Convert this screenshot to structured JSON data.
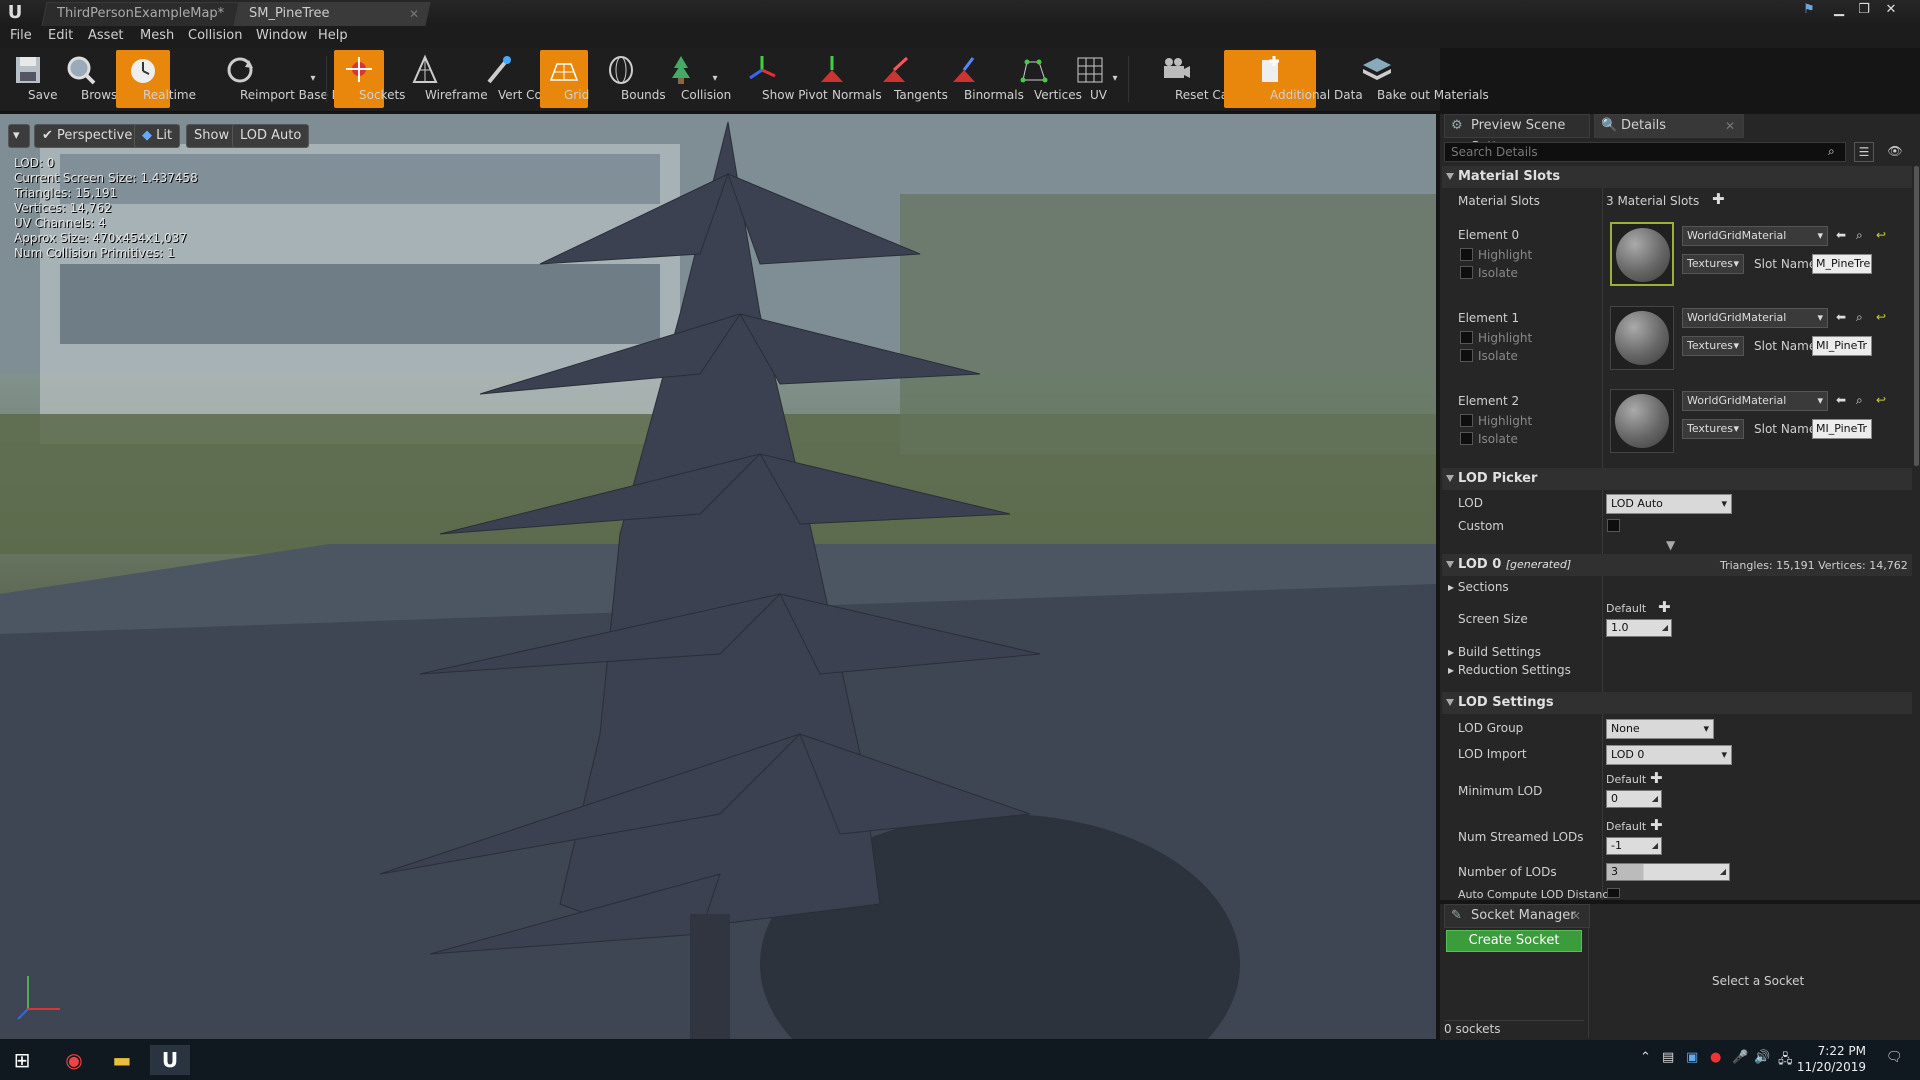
{
  "tabs": [
    {
      "label": "ThirdPersonExampleMap*"
    },
    {
      "label": "SM_PineTree"
    }
  ],
  "menu": [
    "File",
    "Edit",
    "Asset",
    "Mesh",
    "Collision",
    "Window",
    "Help"
  ],
  "toolbar": {
    "save": "Save",
    "browse": "Browse",
    "realtime": "Realtime",
    "reimport": "Reimport Base Mesh",
    "sockets": "Sockets",
    "wireframe": "Wireframe",
    "vert_colors": "Vert Colors",
    "grid": "Grid",
    "bounds": "Bounds",
    "collision": "Collision",
    "show_pivot": "Show Pivot",
    "normals": "Normals",
    "tangents": "Tangents",
    "binormals": "Binormals",
    "vertices": "Vertices",
    "uv": "UV",
    "reset_camera": "Reset Camera",
    "additional_data": "Additional Data",
    "bake_out": "Bake out Materials",
    "accent": "#e8870c"
  },
  "viewport": {
    "perspective": "Perspective",
    "lit": "Lit",
    "show": "Show",
    "lod_auto": "LOD Auto",
    "stats": [
      "LOD:  0",
      "Current Screen Size:  1.437458",
      "Triangles:  15,191",
      "Vertices:  14,762",
      "UV Channels:  4",
      "Approx Size: 470x454x1,037",
      "Num Collision Primitives:  1"
    ]
  },
  "details": {
    "tab_preview": "Preview Scene Sett",
    "tab_details": "Details",
    "search_placeholder": "Search Details",
    "material_slots_section": "Material Slots",
    "material_slots_label": "Material Slots",
    "material_slots_count": "3 Material Slots",
    "highlight": "Highlight",
    "isolate": "Isolate",
    "textures": "Textures",
    "slot_name_label": "Slot Name",
    "elements": [
      {
        "name": "Element 0",
        "material": "WorldGridMaterial",
        "slot": "M_PineTre"
      },
      {
        "name": "Element 1",
        "material": "WorldGridMaterial",
        "slot": "MI_PineTr"
      },
      {
        "name": "Element 2",
        "material": "WorldGridMaterial",
        "slot": "MI_PineTr"
      }
    ],
    "lod_picker_section": "LOD Picker",
    "lod_label": "LOD",
    "lod_value": "LOD Auto",
    "custom_label": "Custom",
    "lod0_section": "LOD 0",
    "lod0_generated": "[generated]",
    "lod0_stats": "Triangles: 15,191    Vertices: 14,762",
    "sections": "Sections",
    "screen_size": "Screen Size",
    "default": "Default",
    "screen_size_value": "1.0",
    "build_settings": "Build Settings",
    "reduction_settings": "Reduction Settings",
    "lod_settings_section": "LOD Settings",
    "lod_group_label": "LOD Group",
    "lod_group_value": "None",
    "lod_import_label": "LOD Import",
    "lod_import_value": "LOD 0",
    "min_lod_label": "Minimum LOD",
    "min_lod_value": "0",
    "num_streamed_label": "Num Streamed LODs",
    "num_streamed_value": "-1",
    "num_lods_label": "Number of LODs",
    "num_lods_value": "3",
    "auto_compute_label": "Auto Compute LOD Distance"
  },
  "socket_manager": {
    "title": "Socket Manager",
    "create": "Create Socket",
    "select": "Select a Socket",
    "count": "0 sockets"
  },
  "taskbar": {
    "time": "7:22 PM",
    "date": "11/20/2019"
  }
}
